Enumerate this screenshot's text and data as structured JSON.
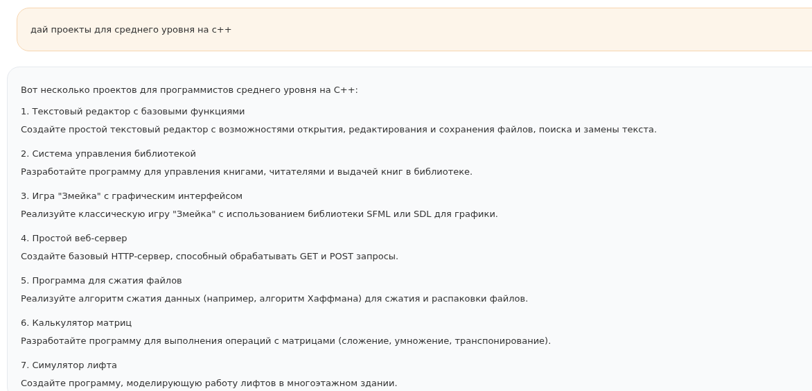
{
  "user_message": {
    "text": "дай проекты для среднего уровня на с++"
  },
  "assistant_message": {
    "intro": "Вот несколько проектов для программистов среднего уровня на C++:",
    "projects": [
      {
        "title": "1. Текстовый редактор с базовыми функциями",
        "description": "Создайте простой текстовый редактор с возможностями открытия, редактирования и сохранения файлов, поиска и замены текста."
      },
      {
        "title": "2. Система управления библиотекой",
        "description": "Разработайте программу для управления книгами, читателями и выдачей книг в библиотеке."
      },
      {
        "title": "3. Игра \"Змейка\" с графическим интерфейсом",
        "description": "Реализуйте классическую игру \"Змейка\" с использованием библиотеки SFML или SDL для графики."
      },
      {
        "title": "4. Простой веб-сервер",
        "description": "Создайте базовый HTTP-сервер, способный обрабатывать GET и POST запросы."
      },
      {
        "title": "5. Программа для сжатия файлов",
        "description": "Реализуйте алгоритм сжатия данных (например, алгоритм Хаффмана) для сжатия и распаковки файлов."
      },
      {
        "title": "6. Калькулятор матриц",
        "description": "Разработайте программу для выполнения операций с матрицами (сложение, умножение, транспонирование)."
      },
      {
        "title": "7. Симулятор лифта",
        "description": "Создайте программу, моделирующую работу лифтов в многоэтажном здании."
      }
    ]
  }
}
